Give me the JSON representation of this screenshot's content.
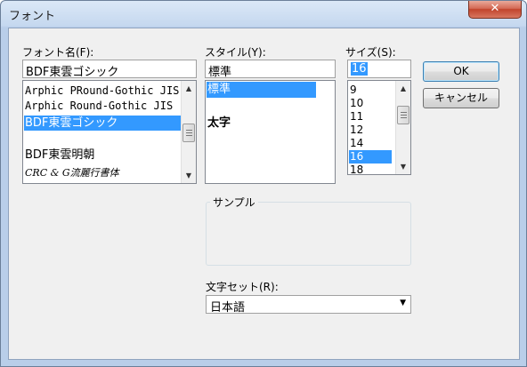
{
  "window": {
    "title": "フォント",
    "close_label": "✕"
  },
  "font_name": {
    "label": "フォント名(F):",
    "value": "BDF東雲ゴシック",
    "items": [
      "Arphic PRound-Gothic JIS",
      "Arphic Round-Gothic JIS",
      "BDF東雲ゴシック",
      "BDF東雲明朝",
      "CRC & G流麗行書体"
    ],
    "selected_index": 2
  },
  "style": {
    "label": "スタイル(Y):",
    "value": "標準",
    "items": [
      "標準",
      "太字"
    ],
    "selected_index": 0
  },
  "size": {
    "label": "サイズ(S):",
    "value": "16",
    "items": [
      "9",
      "10",
      "11",
      "12",
      "14",
      "16",
      "18"
    ],
    "selected_index": 5
  },
  "buttons": {
    "ok": "OK",
    "cancel": "キャンセル"
  },
  "sample": {
    "title": "サンプル"
  },
  "charset": {
    "label": "文字セット(R):",
    "value": "日本語"
  },
  "icons": {
    "scroll_up": "▲",
    "scroll_down": "▼",
    "combo_arrow": "▼"
  },
  "colors": {
    "selection": "#3399ff",
    "close_button": "#c2442c"
  }
}
